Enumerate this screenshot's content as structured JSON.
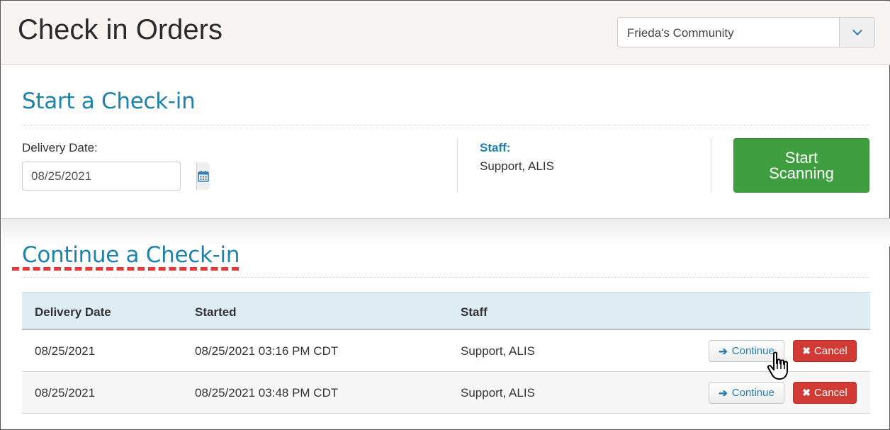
{
  "header": {
    "title": "Check in Orders",
    "community_select": {
      "value": "Frieda's Community"
    }
  },
  "start_section": {
    "title": "Start a Check-in",
    "delivery_date_label": "Delivery Date:",
    "delivery_date_value": "08/25/2021",
    "staff_label": "Staff:",
    "staff_value": "Support, ALIS",
    "start_button_label": "Start Scanning"
  },
  "continue_section": {
    "title": "Continue a Check-in",
    "columns": [
      "Delivery Date",
      "Started",
      "Staff"
    ],
    "rows": [
      {
        "delivery_date": "08/25/2021",
        "started": "08/25/2021 03:16 PM CDT",
        "staff": "Support, ALIS",
        "continue_label": "Continue",
        "cancel_label": "Cancel"
      },
      {
        "delivery_date": "08/25/2021",
        "started": "08/25/2021 03:48 PM CDT",
        "staff": "Support, ALIS",
        "continue_label": "Continue",
        "cancel_label": "Cancel"
      }
    ]
  },
  "colors": {
    "accent": "#1f82ad",
    "start_button": "#3f9e3f",
    "cancel_button": "#d23a35",
    "annotation_underline": "#e5393b",
    "table_header": "#deedf3"
  },
  "icons": {
    "dropdown": "chevron-down-icon",
    "calendar": "calendar-icon",
    "continue": "arrow-right-icon",
    "cancel": "close-icon",
    "cursor": "hand-pointer-icon"
  }
}
